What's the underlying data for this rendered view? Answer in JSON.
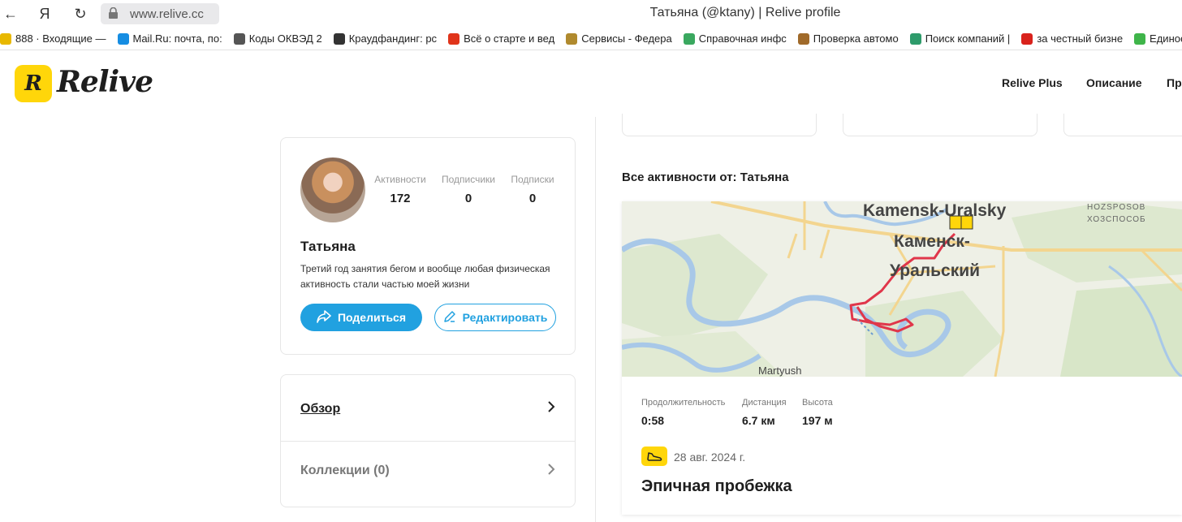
{
  "browser": {
    "url": "www.relive.cc",
    "title": "Татьяна (@ktany) | Relive profile",
    "bookmarks": [
      {
        "label": "888 · Входящие —",
        "color": "#e8b800"
      },
      {
        "label": "Mail.Ru: почта, по:",
        "color": "#168de2"
      },
      {
        "label": "Коды ОКВЭД 2",
        "color": "#555555"
      },
      {
        "label": "Краудфандинг: рс",
        "color": "#333333"
      },
      {
        "label": "Всё о старте и вед",
        "color": "#e0341a"
      },
      {
        "label": "Сервисы - Федера",
        "color": "#b08a2e"
      },
      {
        "label": "Справочная инфс",
        "color": "#3aa85f"
      },
      {
        "label": "Проверка автомо",
        "color": "#a06a2a"
      },
      {
        "label": "Поиск компаний |",
        "color": "#2e9b6b"
      },
      {
        "label": "за честный бизне",
        "color": "#d9221c"
      },
      {
        "label": "Единое с",
        "color": "#3fb54a"
      }
    ]
  },
  "header": {
    "logo": "Relive",
    "nav": [
      "Relive Plus",
      "Описание",
      "Пр"
    ]
  },
  "profile": {
    "stats": [
      {
        "label": "Активности",
        "value": "172"
      },
      {
        "label": "Подписчики",
        "value": "0"
      },
      {
        "label": "Подписки",
        "value": "0"
      }
    ],
    "name": "Татьяна",
    "bio": "Третий год занятия бегом и вообще любая физическая активность стали частью моей жизни",
    "share_label": "Поделиться",
    "edit_label": "Редактировать"
  },
  "menu": {
    "overview": "Обзор",
    "collections": "Коллекции",
    "collections_count": "(0)"
  },
  "activities": {
    "title": "Все активности от: Татьяна",
    "map_labels": {
      "city_en": "Kamensk-Uralsky",
      "city_ru_1": "Каменск-",
      "city_ru_2": "Уральский",
      "area_en": "HOZSPOSOB",
      "area_ru": "ХОЗСПОСОБ",
      "village": "Martyush"
    },
    "stats": [
      {
        "label": "Продолжительность",
        "value": "0:58"
      },
      {
        "label": "Дистанция",
        "value": "6.7 км"
      },
      {
        "label": "Высота",
        "value": "197 м"
      }
    ],
    "date": "28 авг. 2024 г.",
    "name": "Эпичная пробежка"
  },
  "colors": {
    "accent_blue": "#21a1e0",
    "brand_yellow": "#ffd60a",
    "route_red": "#e0364a"
  }
}
